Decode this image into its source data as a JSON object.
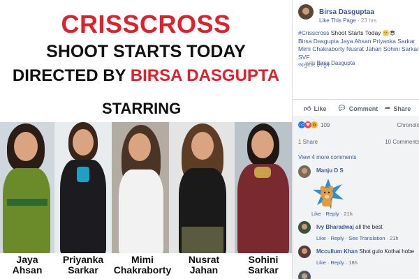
{
  "poster": {
    "title": "CRISSCROSS",
    "subtitle": "SHOOT STARTS TODAY",
    "directed_prefix": "DIRECTED BY",
    "director": "BIRSA DASGUPTA",
    "starring": "STARRING",
    "cast": [
      {
        "first": "Jaya",
        "last": "Ahsan",
        "bg": "#cfd6dd",
        "hair": "#2a1d16",
        "dress": "#6b8a2a"
      },
      {
        "first": "Priyanka",
        "last": "Sarkar",
        "bg": "#e7ecef",
        "hair": "#3a2618",
        "dress": "#1c1c20"
      },
      {
        "first": "Mimi",
        "last": "Chakraborty",
        "bg": "#b3aca3",
        "hair": "#4a3425",
        "dress": "#f2f2f2"
      },
      {
        "first": "Nusrat",
        "last": "Jahan",
        "bg": "#e4e4e4",
        "hair": "#5c3c24",
        "dress": "#1a1a1a"
      },
      {
        "first": "Sohini",
        "last": "Sarkar",
        "bg": "#b9c3c9",
        "hair": "#1f1712",
        "dress": "#7a2a2e"
      }
    ]
  },
  "fb": {
    "page_name": "Birsa Dasguptaa",
    "like_page": "Like This Page",
    "time": "23 hrs",
    "hashtag": "#Crisscross",
    "post_line": " Shoot Starts Today",
    "post_emoji": "🙂😎",
    "post_links": "Birsa Dasgupta Jaya Ahsan Priyanka Sarkar Mimi Chakraborty Nusrat Jahan Sohini Sarkar SVF",
    "see_translation": "অনুবাদ দেখুন",
    "with_prefix": "— with ",
    "with_name": "Birsa Dasgupta",
    "like_label": "Like",
    "comment_label": "Comment",
    "share_label": "Share",
    "reaction_count": "109",
    "chrono": "Chronolo",
    "shares": "1 Share",
    "comment_count": "10 Comments",
    "view_more": "View 4 more comments",
    "comments": [
      {
        "name": "Manju D S",
        "text": "",
        "actions": [
          "Like",
          "Reply",
          "21h"
        ],
        "avatar_color": "#7a6a5a"
      },
      {
        "name": "Ivy Bharadwaj",
        "text": "all the best",
        "actions": [
          "Like",
          "Reply",
          "See Translation",
          "21h"
        ],
        "avatar_color": "#3f4f3a"
      },
      {
        "name": "Mccullum Khan",
        "text": "Shot gulo Kothai hobe",
        "actions": [
          "Like",
          "Reply",
          "18h"
        ],
        "avatar_color": "#5a3a3a"
      }
    ]
  },
  "colors": {
    "accent_red": "#e0202b",
    "fb_link": "#385898",
    "fb_grey": "#606770"
  },
  "icons": [
    "like-thumb-icon",
    "comment-bubble-icon",
    "share-arrow-icon",
    "like-reaction-icon",
    "love-reaction-icon",
    "wow-reaction-icon",
    "bear-sticker-icon"
  ]
}
